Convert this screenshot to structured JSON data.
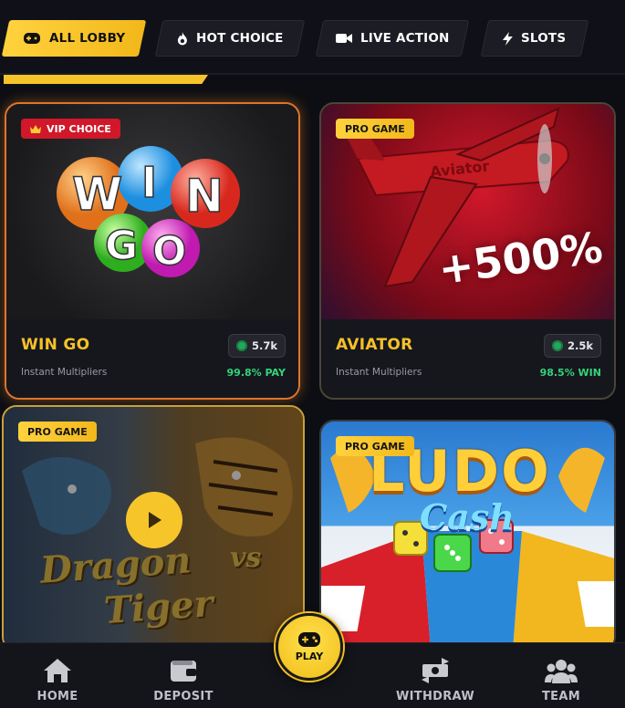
{
  "tabs": [
    {
      "label": "ALL LOBBY",
      "icon": "gamepad-icon",
      "active": true
    },
    {
      "label": "HOT CHOICE",
      "icon": "flame-icon",
      "active": false
    },
    {
      "label": "LIVE ACTION",
      "icon": "video-camera-icon",
      "active": false
    },
    {
      "label": "SLOTS",
      "icon": "lightning-icon",
      "active": false
    }
  ],
  "games": [
    {
      "badge": "VIP CHOICE",
      "title": "WIN GO",
      "subtitle": "Instant Multipliers",
      "players": "5.7k",
      "rate": "99.8% PAY"
    },
    {
      "badge": "PRO GAME",
      "title": "AVIATOR",
      "subtitle": "Instant Multipliers",
      "players": "2.5k",
      "rate": "98.5% WIN",
      "promo": "+500%"
    },
    {
      "badge": "PRO GAME",
      "art_text_1": "Dragon",
      "art_text_2": "vs",
      "art_text_3": "Tiger"
    },
    {
      "badge": "PRO GAME",
      "art_text_1": "LUDO",
      "art_text_2": "Cash"
    }
  ],
  "nav": {
    "home": "HOME",
    "deposit": "DEPOSIT",
    "play": "PLAY",
    "withdraw": "WITHDRAW",
    "team": "TEAM"
  },
  "colors": {
    "accent": "#f6c42a",
    "selected_border": "#e0742a",
    "win_green": "#35d27a",
    "vip_red": "#d0182a"
  }
}
